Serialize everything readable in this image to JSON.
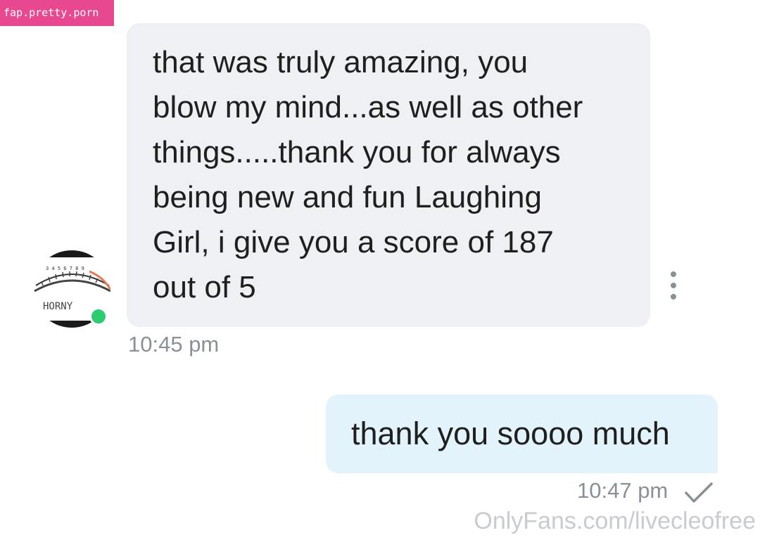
{
  "site_badge": {
    "text": "fap.pretty.porn"
  },
  "contact": {
    "avatar": {
      "icon": "horny-meter-avatar",
      "text": "HORNY"
    },
    "online_status_color": "#2ecc71"
  },
  "messages": [
    {
      "direction": "incoming",
      "text": "that was truly amazing, you\nblow my mind...as well as other\nthings.....thank you for always\nbeing new and fun Laughing\nGirl, i give you a score of 187\nout of 5",
      "time": "10:45 pm",
      "menu_icon": "more-vertical-icon"
    },
    {
      "direction": "outgoing",
      "text": "thank you soooo much",
      "time": "10:47 pm",
      "status_icon": "check-icon"
    }
  ],
  "watermark": {
    "text": "OnlyFans.com/livecleofree"
  },
  "colors": {
    "incoming_bubble": "#eef0f3",
    "outgoing_bubble": "#e3f3fb",
    "timestamp": "#8a9097",
    "badge": "#e8488f"
  }
}
